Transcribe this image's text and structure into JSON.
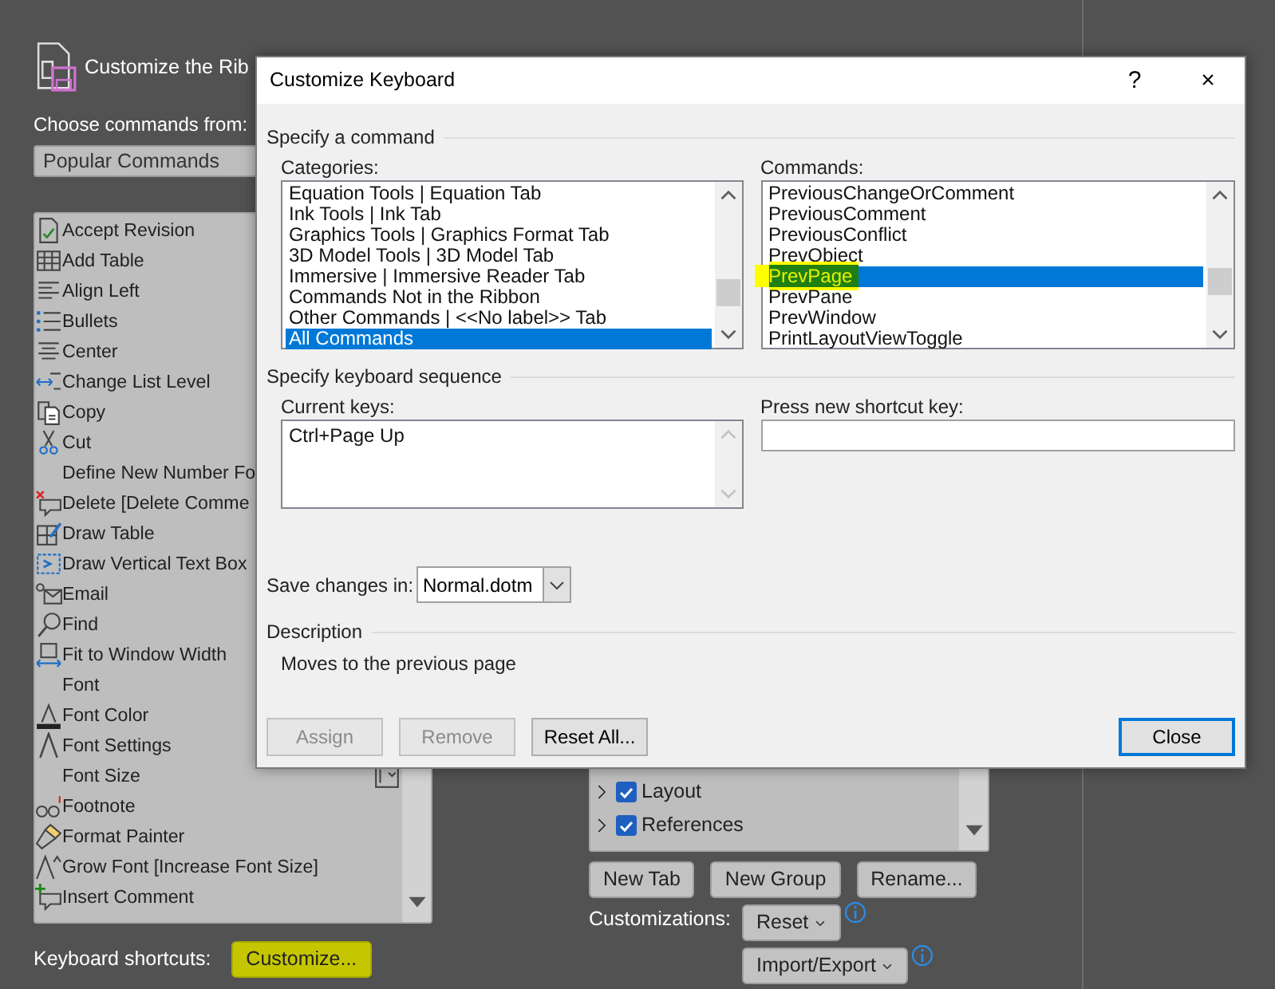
{
  "app": {
    "title": "Customize the Rib",
    "choose_label": "Choose commands from:",
    "choose_value": "Popular Commands",
    "commands": [
      "Accept Revision",
      "Add Table",
      "Align Left",
      "Bullets",
      "Center",
      "Change List Level",
      "Copy",
      "Cut",
      "Define New Number Fo",
      "Delete [Delete Comme",
      "Draw Table",
      "Draw Vertical Text Box",
      "Email",
      "Find",
      "Fit to Window Width",
      "Font",
      "Font Color",
      "Font Settings",
      "Font Size",
      "Footnote",
      "Format Painter",
      "Grow Font [Increase Font Size]",
      "Insert Comment"
    ],
    "keyboard_shortcuts": {
      "label": "Keyboard shortcuts:",
      "button": "Customize...",
      "highlighted": true
    },
    "tabs_tree": [
      {
        "label": "Layout",
        "checked": true,
        "expanded": false
      },
      {
        "label": "References",
        "checked": true,
        "expanded": false
      }
    ],
    "tab_buttons": [
      "New Tab",
      "New Group",
      "Rename..."
    ],
    "customizations": {
      "label": "Customizations:",
      "buttons": [
        "Reset",
        "Import/Export"
      ]
    }
  },
  "dialog": {
    "title": "Customize Keyboard",
    "help": "?",
    "close": "×",
    "command_section": "Specify a command",
    "categories": {
      "label": "Categories:",
      "items": [
        {
          "label": "Equation Tools | Equation Tab",
          "selected": false
        },
        {
          "label": "Ink Tools | Ink Tab",
          "selected": false
        },
        {
          "label": "Graphics Tools | Graphics Format Tab",
          "selected": false
        },
        {
          "label": "3D Model Tools | 3D Model Tab",
          "selected": false
        },
        {
          "label": "Immersive | Immersive Reader Tab",
          "selected": false
        },
        {
          "label": "Commands Not in the Ribbon",
          "selected": false
        },
        {
          "label": "Other Commands | <<No label>> Tab",
          "selected": false
        },
        {
          "label": "All Commands",
          "selected": true
        }
      ]
    },
    "commands": {
      "label": "Commands:",
      "items": [
        {
          "label": "PreviousChangeOrComment",
          "selected": false,
          "highlighted": false
        },
        {
          "label": "PreviousComment",
          "selected": false,
          "highlighted": false
        },
        {
          "label": "PreviousConflict",
          "selected": false,
          "highlighted": false
        },
        {
          "label": "PrevObject",
          "selected": false,
          "highlighted": false
        },
        {
          "label": "PrevPage",
          "selected": true,
          "highlighted": true
        },
        {
          "label": "PrevPane",
          "selected": false,
          "highlighted": false
        },
        {
          "label": "PrevWindow",
          "selected": false,
          "highlighted": false
        },
        {
          "label": "PrintLayoutViewToggle",
          "selected": false,
          "highlighted": false
        }
      ]
    },
    "sequence_section": "Specify keyboard sequence",
    "current_keys": {
      "label": "Current keys:",
      "items": [
        "Ctrl+Page Up"
      ]
    },
    "new_key": {
      "label": "Press new shortcut key:"
    },
    "save_in": {
      "label": "Save changes in:",
      "value": "Normal.dotm"
    },
    "description": {
      "heading": "Description",
      "text": "Moves to the previous page"
    },
    "buttons": [
      {
        "label": "Assign",
        "disabled": true,
        "default": false
      },
      {
        "label": "Remove",
        "disabled": true,
        "default": false
      },
      {
        "label": "Reset All...",
        "disabled": false,
        "default": false
      },
      {
        "label": "Close",
        "disabled": false,
        "default": true
      }
    ]
  }
}
